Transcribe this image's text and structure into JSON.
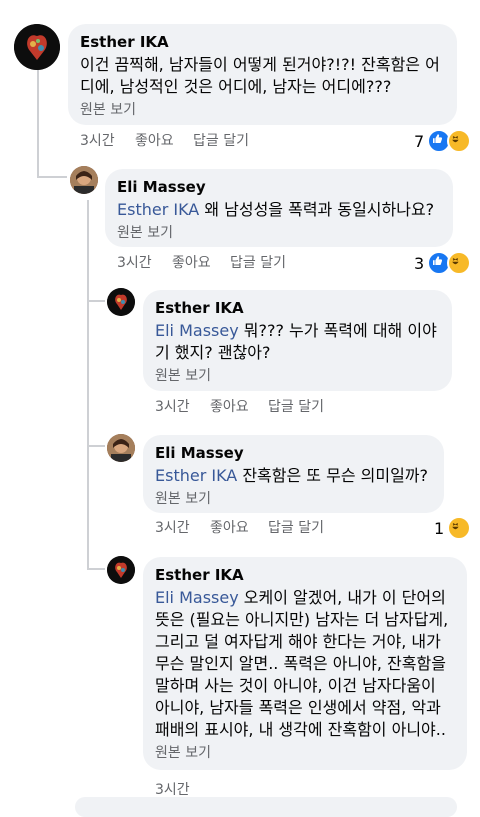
{
  "comments": [
    {
      "author": "Esther IKA",
      "mention": "",
      "line1": "이건 끔찍해, 남자들이 어떻게 된거야?!?! 잔혹함은 어",
      "line2": "디에, 남성적인 것은 어디에, 남자는 어디에???",
      "see_original": "원본 보기",
      "time": "3시간",
      "like": "좋아요",
      "reply": "답글 달기",
      "reaction_count": "7"
    },
    {
      "author": "Eli Massey",
      "mention": "Esther IKA",
      "line1": " 왜 남성성을 폭력과 동일시하나요?",
      "see_original": "원본 보기",
      "time": "3시간",
      "like": "좋아요",
      "reply": "답글 달기",
      "reaction_count": "3"
    },
    {
      "author": "Esther IKA",
      "mention": "Eli Massey",
      "line1": " 뭐??? 누가 폭력에 대해 이야",
      "line2": "기 했지? 괜찮아?",
      "see_original": "원본 보기",
      "time": "3시간",
      "like": "좋아요",
      "reply": "답글 달기"
    },
    {
      "author": "Eli Massey",
      "mention": "Esther IKA",
      "line1": " 잔혹함은 또 무슨 의미일까?",
      "see_original": "원본 보기",
      "time": "3시간",
      "like": "좋아요",
      "reply": "답글 달기",
      "reaction_count": "1"
    },
    {
      "author": "Esther IKA",
      "mention": "Eli Massey",
      "line1": " 오케이 알겠어, 내가 이 단어의",
      "lines": [
        "뜻은 (필요는 아니지만) 남자는 더 남자답게,",
        "그리고 덜 여자답게 해야 한다는 거야, 내가",
        "무슨 말인지 알면.. 폭력은 아니야, 잔혹함을",
        "말하며 사는 것이 아니야, 이건 남자다움이",
        "아니야, 남자들 폭력은 인생에서 약점, 악과",
        "패배의 표시야, 내 생각에 잔혹함이 아니야.."
      ],
      "see_original": "원본 보기",
      "time": "3시간"
    }
  ],
  "colors": {
    "bubble": "#f0f2f5",
    "mention": "#385898",
    "like": "#1877f2",
    "haha": "#f7b928"
  }
}
